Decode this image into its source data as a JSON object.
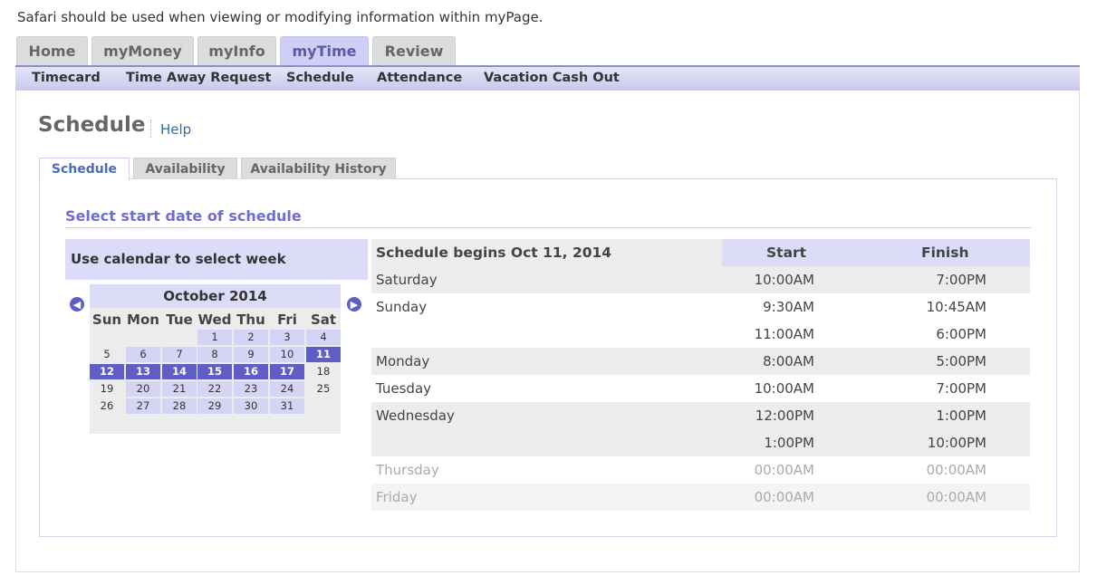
{
  "notice": "Safari should be used when viewing or modifying information within myPage.",
  "top_tabs": [
    "Home",
    "myMoney",
    "myInfo",
    "myTime",
    "Review"
  ],
  "sub_nav": [
    "Timecard",
    "Time Away Request",
    "Schedule",
    "Attendance",
    "Vacation Cash Out"
  ],
  "page": {
    "title": "Schedule",
    "help": "Help"
  },
  "sub_tabs": [
    "Schedule",
    "Availability",
    "Availability History"
  ],
  "section_heading": "Select start date of schedule",
  "calendar": {
    "header": "Use calendar to select week",
    "month": "October 2014",
    "prev_icon": "arrow-left-circle-icon",
    "next_icon": "arrow-right-circle-icon",
    "weekdays": [
      "Sun",
      "Mon",
      "Tue",
      "Wed",
      "Thu",
      "Fri",
      "Sat"
    ],
    "weeks": [
      [
        "",
        "",
        "",
        "1",
        "2",
        "3",
        "4"
      ],
      [
        "5",
        "6",
        "7",
        "8",
        "9",
        "10",
        "11"
      ],
      [
        "12",
        "13",
        "14",
        "15",
        "16",
        "17",
        "18"
      ],
      [
        "19",
        "20",
        "21",
        "22",
        "23",
        "24",
        "25"
      ],
      [
        "26",
        "27",
        "28",
        "29",
        "30",
        "31",
        ""
      ],
      [
        "",
        "",
        "",
        "",
        "",
        "",
        ""
      ]
    ],
    "selected_days": [
      "11",
      "12",
      "13",
      "14",
      "15",
      "16",
      "17"
    ]
  },
  "schedule": {
    "title": "Schedule begins Oct 11, 2014",
    "col_start": "Start",
    "col_finish": "Finish",
    "rows": [
      {
        "day": "Saturday",
        "start": "10:00AM",
        "finish": "7:00PM"
      },
      {
        "day": "Sunday",
        "start": "9:30AM",
        "finish": "10:45AM"
      },
      {
        "day": "",
        "start": "11:00AM",
        "finish": "6:00PM"
      },
      {
        "day": "Monday",
        "start": "8:00AM",
        "finish": "5:00PM"
      },
      {
        "day": "Tuesday",
        "start": "10:00AM",
        "finish": "7:00PM"
      },
      {
        "day": "Wednesday",
        "start": "12:00PM",
        "finish": "1:00PM"
      },
      {
        "day": "",
        "start": "1:00PM",
        "finish": "10:00PM"
      },
      {
        "day": "Thursday",
        "start": "00:00AM",
        "finish": "00:00AM"
      },
      {
        "day": "Friday",
        "start": "00:00AM",
        "finish": "00:00AM"
      }
    ]
  },
  "colors": {
    "accent": "#5e5ec4",
    "light_accent": "#dcdcf8",
    "link": "#2a6fb0"
  }
}
